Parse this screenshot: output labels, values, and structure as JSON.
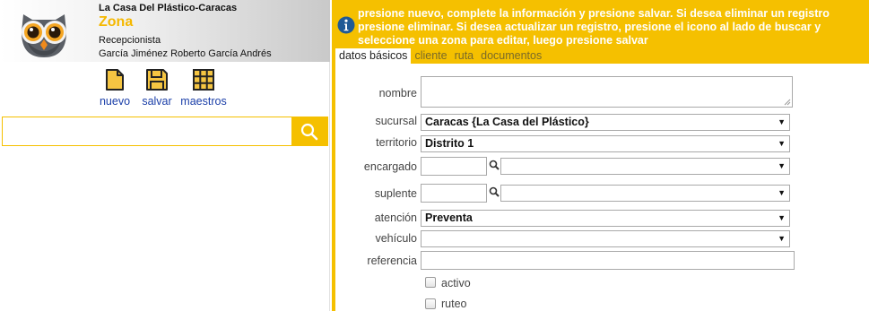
{
  "header": {
    "company": "La Casa Del Plástico-Caracas",
    "module": "Zona",
    "role": "Recepcionista",
    "user": "García Jiménez Roberto García Andrés",
    "logo_icon": "owl-logo-icon"
  },
  "toolbar": {
    "nuevo_label": "nuevo",
    "salvar_label": "salvar",
    "maestros_label": "maestros"
  },
  "search": {
    "value": "",
    "placeholder": "",
    "button_icon": "search-icon"
  },
  "info": {
    "icon": "info-icon",
    "message": "presione nuevo, complete la información y presione salvar. Si desea eliminar un registro presione eliminar. Si desea actualizar un registro, presione el icono al lado de buscar y seleccione una zona para editar, luego presione salvar"
  },
  "tabs": [
    {
      "label": "datos básicos",
      "active": true
    },
    {
      "label": "cliente",
      "active": false
    },
    {
      "label": "ruta",
      "active": false
    },
    {
      "label": "documentos",
      "active": false
    }
  ],
  "form": {
    "nombre": {
      "label": "nombre",
      "value": ""
    },
    "sucursal": {
      "label": "sucursal",
      "value": "Caracas {La Casa del Plástico}"
    },
    "territorio": {
      "label": "territorio",
      "value": "Distrito 1"
    },
    "encargado": {
      "label": "encargado",
      "code": "",
      "value": ""
    },
    "suplente": {
      "label": "suplente",
      "code": "",
      "value": ""
    },
    "atencion": {
      "label": "atención",
      "value": "Preventa"
    },
    "vehiculo": {
      "label": "vehículo",
      "value": ""
    },
    "referencia": {
      "label": "referencia",
      "value": ""
    },
    "activo": {
      "label": "activo",
      "checked": false
    },
    "ruteo": {
      "label": "ruteo",
      "checked": false
    }
  },
  "colors": {
    "accent": "#f5c000",
    "module_title": "#f5b800",
    "link": "#1a3ea8"
  }
}
